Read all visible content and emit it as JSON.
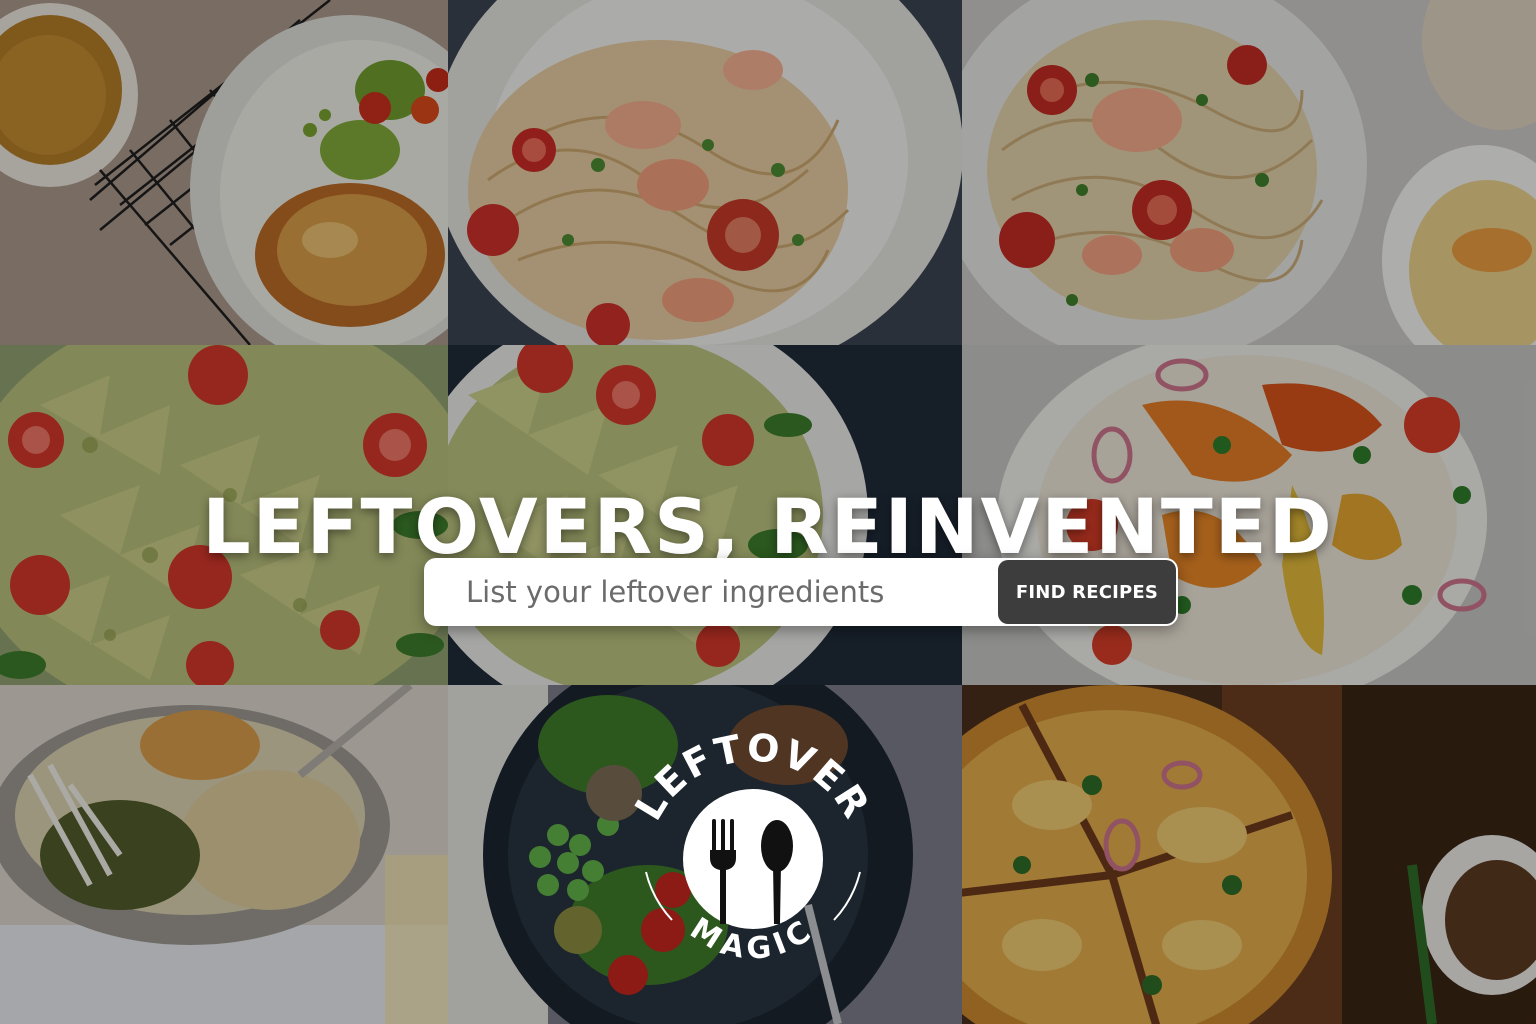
{
  "hero": {
    "title": "LEFTOVERS, REINVENTED"
  },
  "search": {
    "placeholder": "List your leftover ingredients",
    "value": "",
    "button_label": "FIND RECIPES"
  },
  "logo": {
    "top_text": "LEFTOVER",
    "bottom_text": "MAGIC",
    "icon": "fork-and-spoon-icon"
  },
  "tiles": [
    {
      "name": "photo-soup-and-fritter-plate",
      "dish": "fritter"
    },
    {
      "name": "photo-shrimp-pasta-white-plate",
      "dish": "shrimp-pasta"
    },
    {
      "name": "photo-shrimp-pasta-bowl",
      "dish": "shrimp-pasta"
    },
    {
      "name": "photo-pesto-bowtie-pasta",
      "dish": "pesto-pasta"
    },
    {
      "name": "photo-pesto-bowtie-pasta-plate",
      "dish": "pesto-pasta"
    },
    {
      "name": "photo-roasted-pepper-salad",
      "dish": "pepper-salad"
    },
    {
      "name": "photo-quinoa-grain-bowl",
      "dish": "grain-bowl"
    },
    {
      "name": "photo-pea-salad-dark-bowl",
      "dish": "pea-salad"
    },
    {
      "name": "photo-pizza-on-board",
      "dish": "pizza"
    }
  ],
  "colors": {
    "button_bg": "#3d3d3d",
    "title_text": "#ffffff",
    "logo": "#ffffff",
    "overlay": "rgba(0,0,0,0.28)"
  }
}
